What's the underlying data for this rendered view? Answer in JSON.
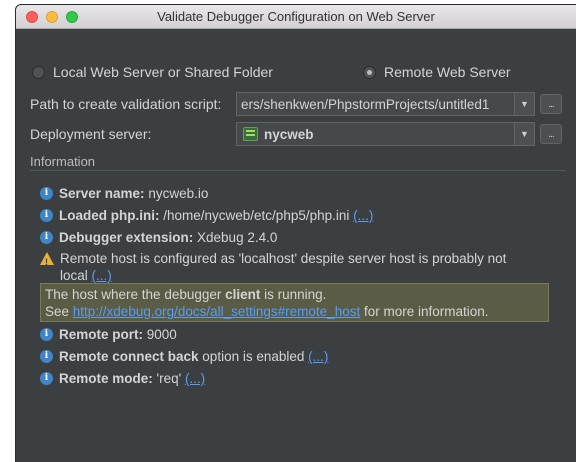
{
  "window": {
    "title": "Validate Debugger Configuration on Web Server"
  },
  "mode": {
    "local_label": "Local Web Server or Shared Folder",
    "remote_label": "Remote Web Server",
    "selected": "remote"
  },
  "path_field": {
    "label": "Path to create validation script:",
    "value": "ers/shenkwen/PhpstormProjects/untitled1",
    "more_label": "..."
  },
  "deployment_field": {
    "label": "Deployment server:",
    "value": "nycweb",
    "more_label": "..."
  },
  "information": {
    "title": "Information",
    "items": [
      {
        "key": "Server name:",
        "value": " nycweb.io",
        "link": ""
      },
      {
        "key": "Loaded php.ini:",
        "value": " /home/nycweb/etc/php5/php.ini ",
        "link": "(...)"
      },
      {
        "key": "Debugger extension:",
        "value": " Xdebug 2.4.0",
        "link": ""
      }
    ],
    "warning": {
      "line1": "Remote host is configured as 'localhost' despite server host is probably not",
      "line2": "local ",
      "link": "(...)"
    },
    "tooltip": {
      "line1_pre": "The host where the debugger ",
      "line1_bold": "client",
      "line1_post": " is running.",
      "line2_pre": "See ",
      "line2_link": "http://xdebug.org/docs/all_settings#remote_host",
      "line2_post": " for more information."
    },
    "items_after": [
      {
        "key": "Remote port:",
        "value": " 9000",
        "link": ""
      },
      {
        "key": "Remote connect back",
        "value": " option is enabled ",
        "link": "(...)"
      },
      {
        "key": "Remote mode:",
        "value": " 'req' ",
        "link": "(...)"
      }
    ]
  },
  "icons": {
    "info": "info-icon",
    "warning": "warning-icon",
    "server": "server-icon",
    "dropdown": "chevron-down-icon"
  },
  "colors": {
    "background": "#3c3f41",
    "link": "#589df6",
    "info_icon": "#3e86c5",
    "warning_icon": "#e8b234"
  }
}
